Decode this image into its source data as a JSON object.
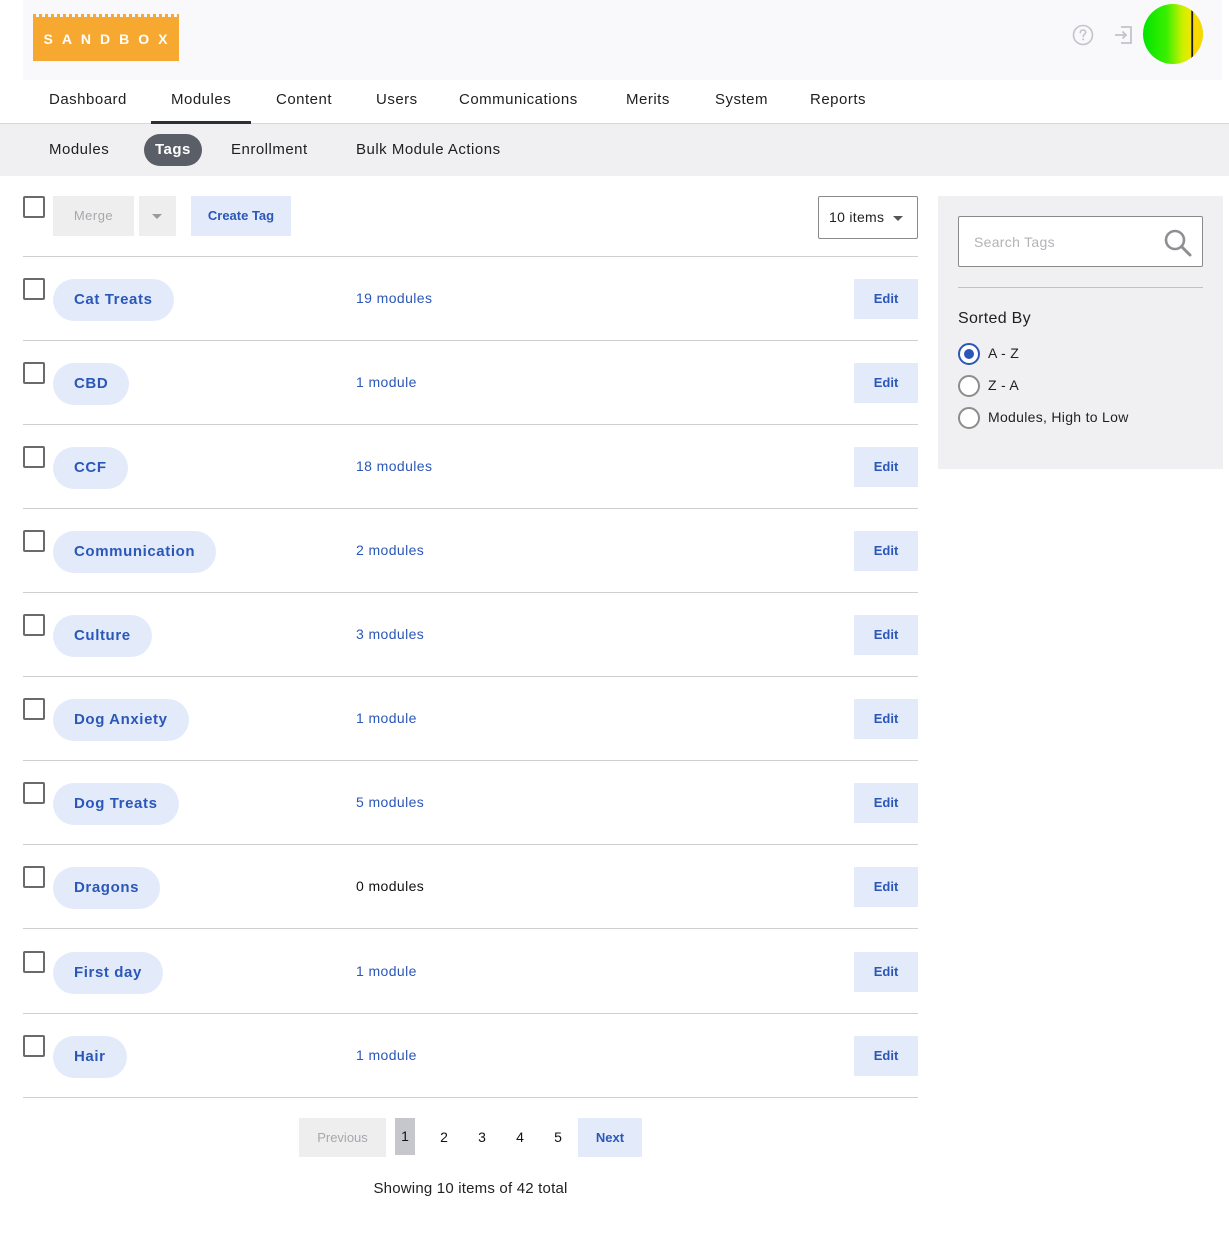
{
  "header": {
    "logo_text": "SANDBOX",
    "help_icon": "help-circle-icon",
    "logout_icon": "sign-out-icon",
    "avatar_colors": [
      "#00e400",
      "#f3e700"
    ]
  },
  "main_nav": {
    "items": [
      "Dashboard",
      "Modules",
      "Content",
      "Users",
      "Communications",
      "Merits",
      "System",
      "Reports"
    ],
    "active": "Modules"
  },
  "sub_nav": {
    "items": [
      "Modules",
      "Tags",
      "Enrollment",
      "Bulk Module Actions"
    ],
    "active": "Tags"
  },
  "toolbar": {
    "merge_label": "Merge",
    "create_tag_label": "Create Tag",
    "items_per_page": "10 items"
  },
  "tags": [
    {
      "name": "Cat Treats",
      "count": "19 modules",
      "edit": "Edit"
    },
    {
      "name": "CBD",
      "count": "1 module",
      "edit": "Edit"
    },
    {
      "name": "CCF",
      "count": "18 modules",
      "edit": "Edit"
    },
    {
      "name": "Communication",
      "count": "2 modules",
      "edit": "Edit"
    },
    {
      "name": "Culture",
      "count": "3 modules",
      "edit": "Edit"
    },
    {
      "name": "Dog Anxiety",
      "count": "1 module",
      "edit": "Edit"
    },
    {
      "name": "Dog Treats",
      "count": "5 modules",
      "edit": "Edit"
    },
    {
      "name": "Dragons",
      "count": "0 modules",
      "edit": "Edit"
    },
    {
      "name": "First day",
      "count": "1 module",
      "edit": "Edit"
    },
    {
      "name": "Hair",
      "count": "1 module",
      "edit": "Edit"
    }
  ],
  "pagination": {
    "previous": "Previous",
    "pages": [
      "1",
      "2",
      "3",
      "4",
      "5"
    ],
    "current": "1",
    "next": "Next",
    "summary": "Showing 10 items of 42 total"
  },
  "sidebar": {
    "search_placeholder": "Search Tags",
    "sorted_by_title": "Sorted By",
    "sort_options": [
      "A - Z",
      "Z - A",
      "Modules, High to Low"
    ],
    "selected_sort": "A - Z"
  },
  "colors": {
    "accent": "#2b57b8",
    "pill_bg": "#e3ebfb",
    "logo": "#f7a831"
  }
}
